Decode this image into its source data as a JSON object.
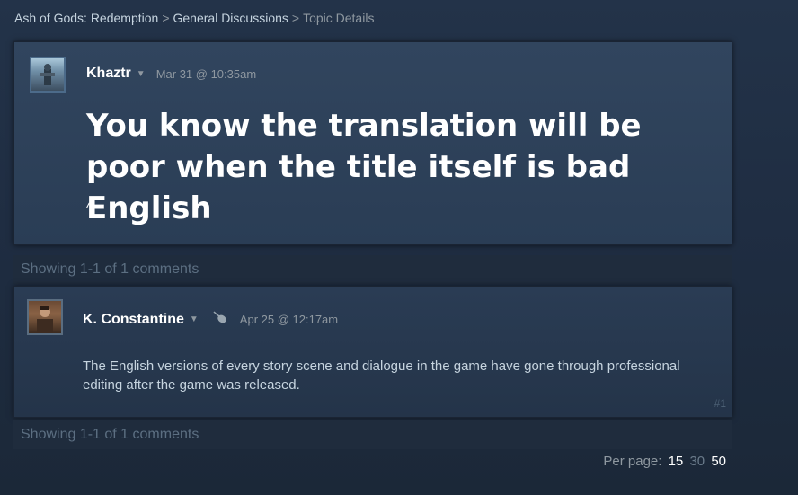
{
  "breadcrumb": {
    "game": "Ash of Gods: Redemption",
    "forum": "General Discussions",
    "current": "Topic Details",
    "separator": ">"
  },
  "topic": {
    "author": "Khaztr",
    "date": "Mar 31 @ 10:35am",
    "title": "You know the translation will be poor when the title itself is bad English",
    "body": "^"
  },
  "showing_top": "Showing 1-1 of 1 comments",
  "comment": {
    "author": "K. Constantine",
    "date": "Apr 25 @ 12:17am",
    "text": "The English versions of every story scene and dialogue in the game have gone through professional editing after the game was released.",
    "number": "#1",
    "badge_icon": "mouse-icon"
  },
  "showing_bottom": "Showing 1-1 of 1 comments",
  "per_page": {
    "label": "Per page:",
    "options": [
      "15",
      "30",
      "50"
    ]
  },
  "colors": {
    "background": "#1b2838",
    "accent_text": "#c6d4df",
    "muted_text": "#8f98a0"
  }
}
